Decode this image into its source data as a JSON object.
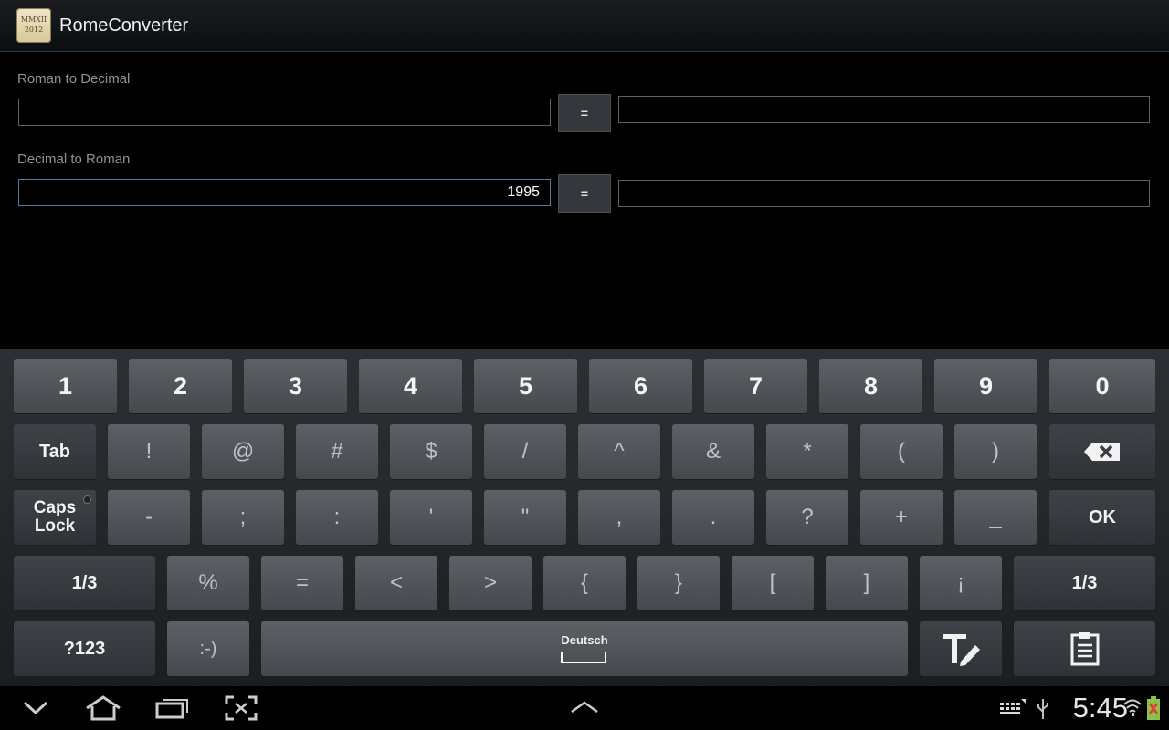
{
  "app": {
    "title": "RomeConverter",
    "icon_text_top": "MMXII",
    "icon_text_bottom": "2012"
  },
  "roman_to_decimal": {
    "label": "Roman to Decimal",
    "input_value": "",
    "button_label": "=",
    "result_value": ""
  },
  "decimal_to_roman": {
    "label": "Decimal to Roman",
    "input_value": "1995",
    "button_label": "=",
    "result_value": ""
  },
  "keyboard": {
    "row1": [
      "1",
      "2",
      "3",
      "4",
      "5",
      "6",
      "7",
      "8",
      "9",
      "0"
    ],
    "tab": "Tab",
    "row2": [
      "!",
      "@",
      "#",
      "$",
      "/",
      "^",
      "&",
      "*",
      "(",
      ")"
    ],
    "caps_line1": "Caps",
    "caps_line2": "Lock",
    "row3": [
      "-",
      ";",
      ":",
      "'",
      "\"",
      ",",
      ".",
      "?",
      "+",
      "_"
    ],
    "ok": "OK",
    "page_left": "1/3",
    "row4": [
      "%",
      "=",
      "<",
      ">",
      "{",
      "}",
      "[",
      "]",
      "¡"
    ],
    "page_right": "1/3",
    "mode": "?123",
    "smiley": ":-)",
    "space_language": "Deutsch"
  },
  "status": {
    "clock": "5:45"
  }
}
